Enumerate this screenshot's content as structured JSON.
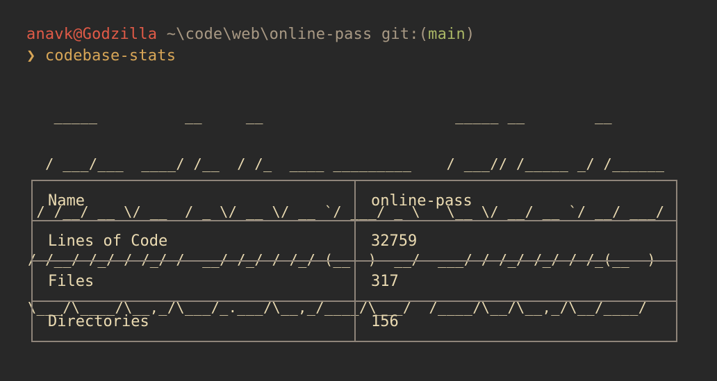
{
  "prompt": {
    "user_host": "anavk@Godzilla",
    "path": "~\\code\\web\\online-pass",
    "git_label": "git:",
    "git_open": "(",
    "branch": "main",
    "git_close": ")"
  },
  "command": {
    "prompt_symbol": "❯",
    "text": "codebase-stats"
  },
  "banner": {
    "lines": [
      "   _____          __     __                      _____ __        __      ",
      "  / ___/___  ____/ /__  / /_  ____ _________    / ___// /_____ _/ /______",
      " / /__/ __ \\/ __  / _ \\/ __ \\/ __ `/ ___/ _ \\   \\__ \\/ __/ __ `/ __/ ___/",
      "/ /__/ /_/ / /_/ /  __/ /_/ / /_/ (__  )  __/  ___/ / /_/ /_/ / /_(__  ) ",
      "\\___/\\____/\\__,_/\\___/_.___/\\__,_/____/\\___/  /____/\\__/\\__,_/\\__/____/  "
    ]
  },
  "stats": {
    "rows": [
      {
        "key": "Name",
        "value": "online-pass"
      },
      {
        "key": "Lines of Code",
        "value": "32759"
      },
      {
        "key": "Files",
        "value": "317"
      },
      {
        "key": "Directories",
        "value": "156"
      }
    ]
  },
  "colors": {
    "background": "#282828",
    "foreground": "#ebdbb2",
    "user": "#e05a47",
    "path": "#a89984",
    "branch": "#a9b665",
    "command": "#d8a657",
    "table_border": "#8f857a"
  }
}
